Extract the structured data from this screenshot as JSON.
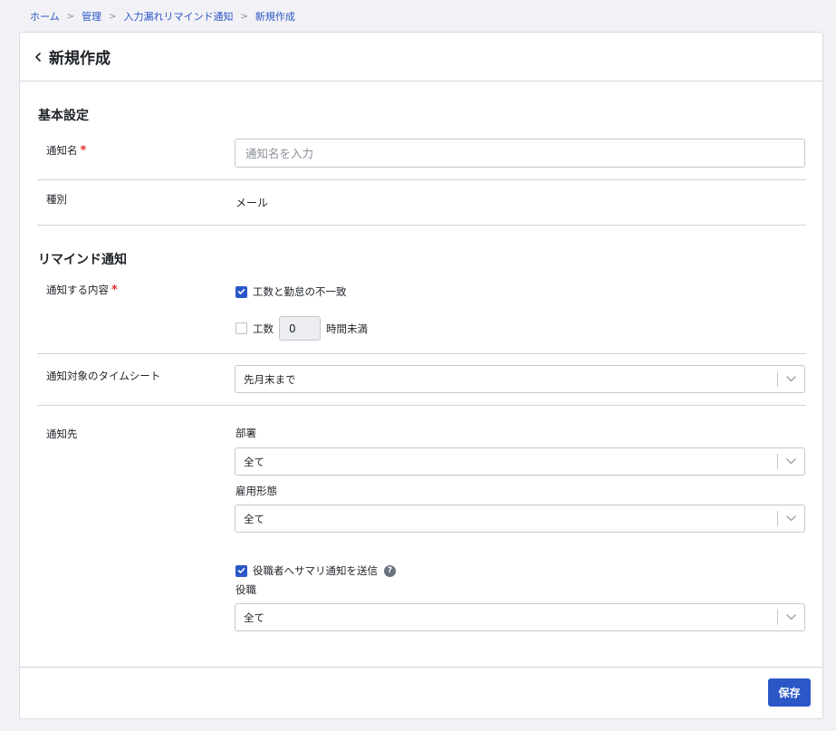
{
  "breadcrumb": {
    "items": [
      "ホーム",
      "管理",
      "入力漏れリマインド通知",
      "新規作成"
    ],
    "separator": ">"
  },
  "header": {
    "title": "新規作成"
  },
  "basic": {
    "section_title": "基本設定",
    "name_label": "通知名",
    "required_mark": "*",
    "name_placeholder": "通知名を入力",
    "name_value": "",
    "type_label": "種別",
    "type_value": "メール"
  },
  "remind": {
    "section_title": "リマインド通知",
    "content_label": "通知する内容",
    "required_mark": "*",
    "option_mismatch_label": "工数と勤怠の不一致",
    "option_mismatch_checked": true,
    "option_hours_label": "工数",
    "option_hours_checked": false,
    "option_hours_value": "0",
    "option_hours_suffix": "時間未満",
    "target_label": "通知対象のタイムシート",
    "target_value": "先月末まで",
    "dest_label": "通知先",
    "department_label": "部署",
    "department_value": "全て",
    "employment_label": "雇用形態",
    "employment_value": "全て",
    "summary_label": "役職者へサマリ通知を送信",
    "summary_checked": true,
    "help_glyph": "?",
    "position_label": "役職",
    "position_value": "全て"
  },
  "footer": {
    "save_label": "保存"
  },
  "colors": {
    "accent": "#2b57c7",
    "required": "#e0302c"
  },
  "icons": {
    "back": "chevron-left-icon",
    "dropdown": "chevron-down-icon",
    "help": "help-icon",
    "check": "check-icon"
  }
}
